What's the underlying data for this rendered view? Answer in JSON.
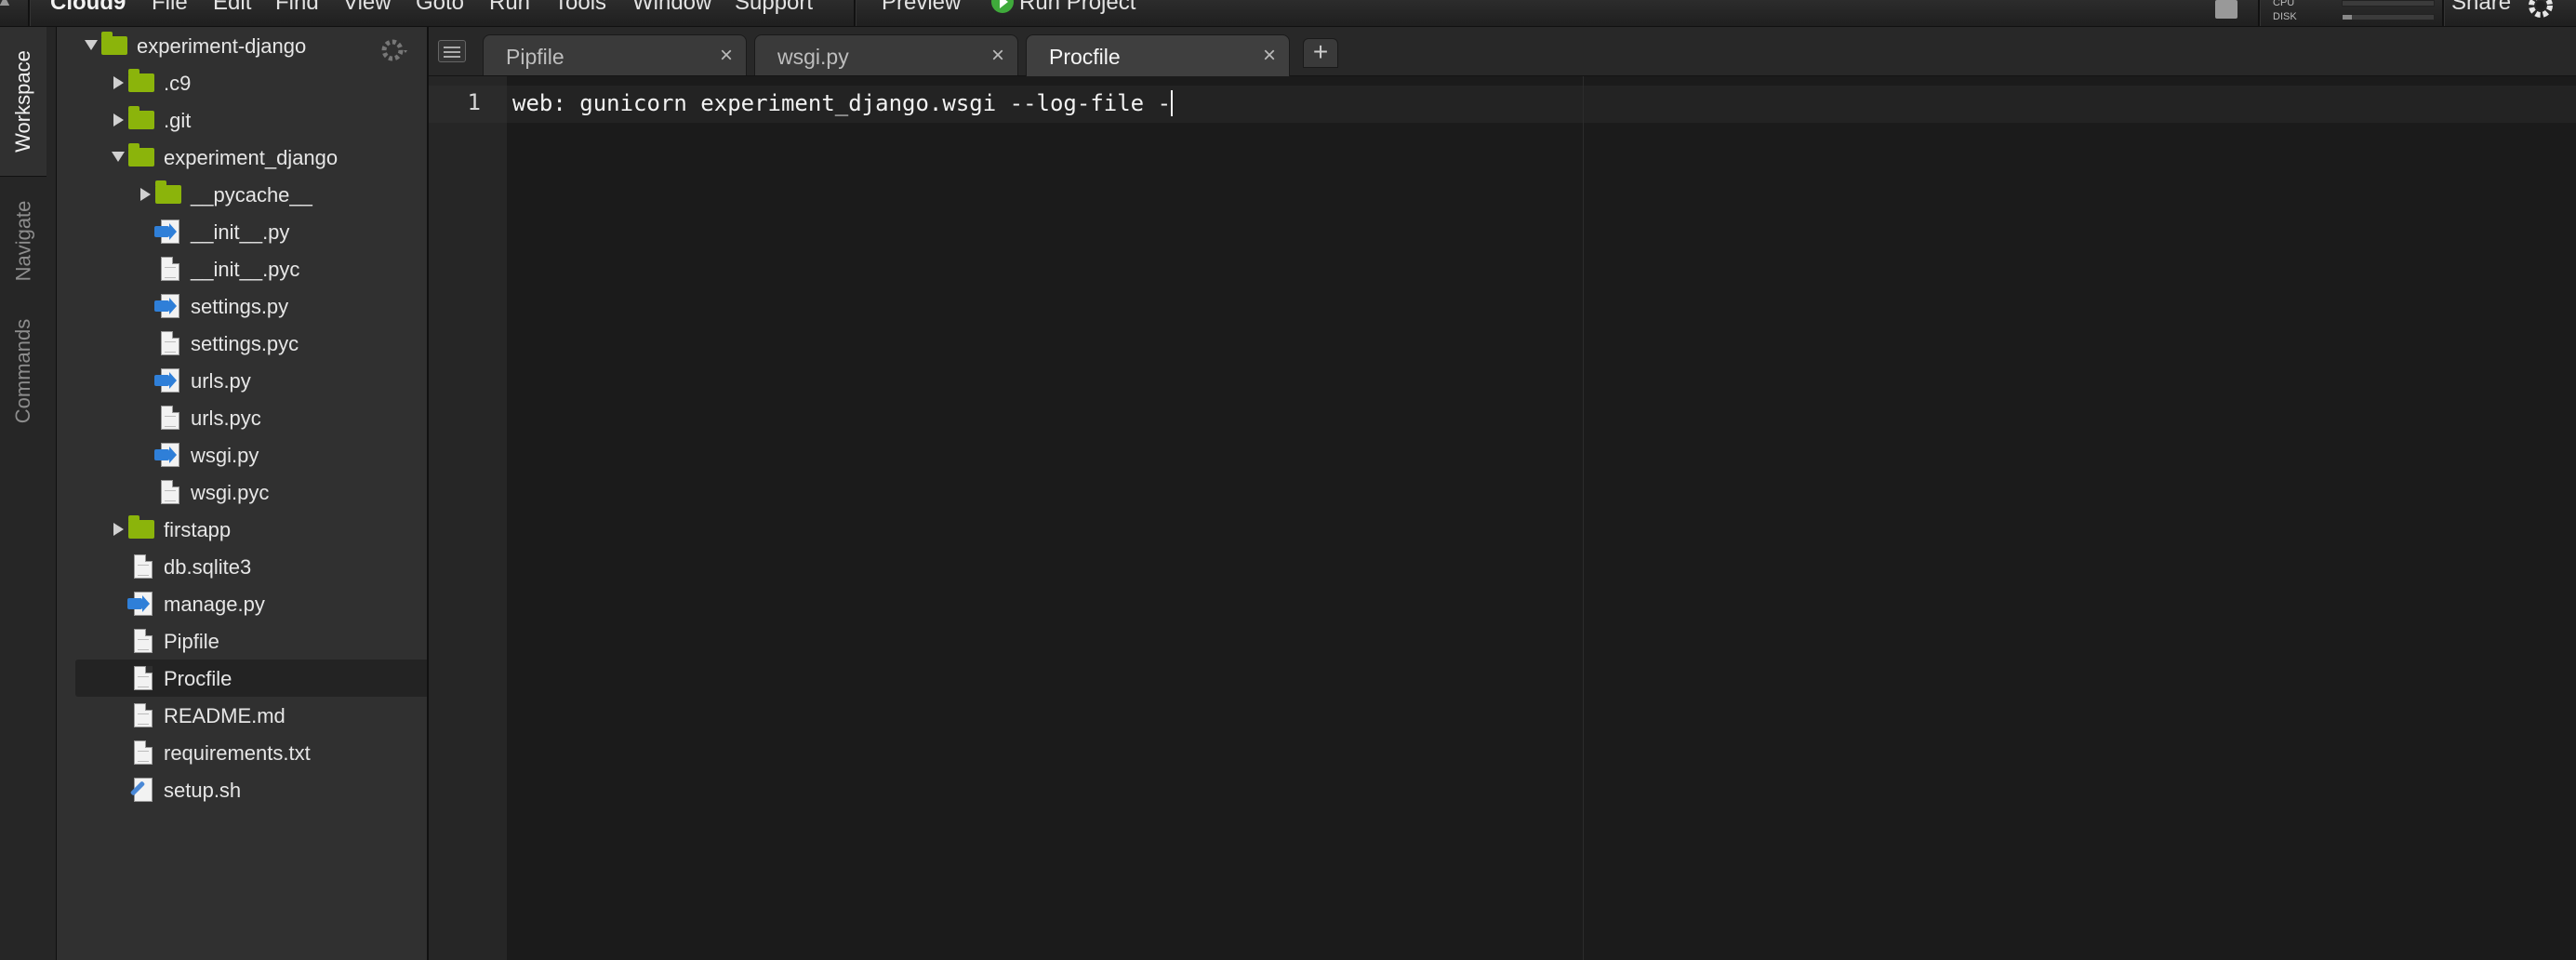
{
  "menubar": {
    "brand": "Cloud9",
    "items": [
      "File",
      "Edit",
      "Find",
      "View",
      "Goto",
      "Run",
      "Tools",
      "Window",
      "Support"
    ],
    "preview": "Preview",
    "run_project": "Run Project",
    "cpu_label": "CPU",
    "disk_label": "DISK",
    "cpu_usage_fraction": 0.0,
    "disk_usage_fraction": 0.1,
    "share": "Share"
  },
  "lefttabs": [
    "Workspace",
    "Navigate",
    "Commands"
  ],
  "tree": {
    "items": [
      {
        "label": "experiment-django",
        "type": "folder",
        "state": "expanded",
        "depth": 0
      },
      {
        "label": ".c9",
        "type": "folder",
        "state": "collapsed",
        "depth": 1
      },
      {
        "label": ".git",
        "type": "folder",
        "state": "collapsed",
        "depth": 1
      },
      {
        "label": "experiment_django",
        "type": "folder",
        "state": "expanded",
        "depth": 1
      },
      {
        "label": "__pycache__",
        "type": "folder",
        "state": "collapsed",
        "depth": 2
      },
      {
        "label": "__init__.py",
        "type": "python",
        "depth": 2
      },
      {
        "label": "__init__.pyc",
        "type": "file",
        "depth": 2
      },
      {
        "label": "settings.py",
        "type": "python",
        "depth": 2
      },
      {
        "label": "settings.pyc",
        "type": "file",
        "depth": 2
      },
      {
        "label": "urls.py",
        "type": "python",
        "depth": 2
      },
      {
        "label": "urls.pyc",
        "type": "file",
        "depth": 2
      },
      {
        "label": "wsgi.py",
        "type": "python",
        "depth": 2
      },
      {
        "label": "wsgi.pyc",
        "type": "file",
        "depth": 2
      },
      {
        "label": "firstapp",
        "type": "folder",
        "state": "collapsed",
        "depth": 1
      },
      {
        "label": "db.sqlite3",
        "type": "file",
        "depth": 1
      },
      {
        "label": "manage.py",
        "type": "python",
        "depth": 1
      },
      {
        "label": "Pipfile",
        "type": "file",
        "depth": 1
      },
      {
        "label": "Procfile",
        "type": "file",
        "depth": 1,
        "selected": true
      },
      {
        "label": "README.md",
        "type": "file",
        "depth": 1
      },
      {
        "label": "requirements.txt",
        "type": "file",
        "depth": 1
      },
      {
        "label": "setup.sh",
        "type": "shell",
        "depth": 1
      }
    ]
  },
  "tabs": [
    {
      "label": "Pipfile",
      "close": "×",
      "active": false
    },
    {
      "label": "wsgi.py",
      "close": "×",
      "active": false
    },
    {
      "label": "Procfile",
      "close": "×",
      "active": true
    }
  ],
  "new_tab": "+",
  "editor": {
    "line_number": "1",
    "code": "web: gunicorn experiment_django.wsgi --log-file -"
  },
  "colors": {
    "folder": "#8bb40b",
    "run_button": "#3faa3b",
    "python_icon": "#2f7fd8"
  }
}
